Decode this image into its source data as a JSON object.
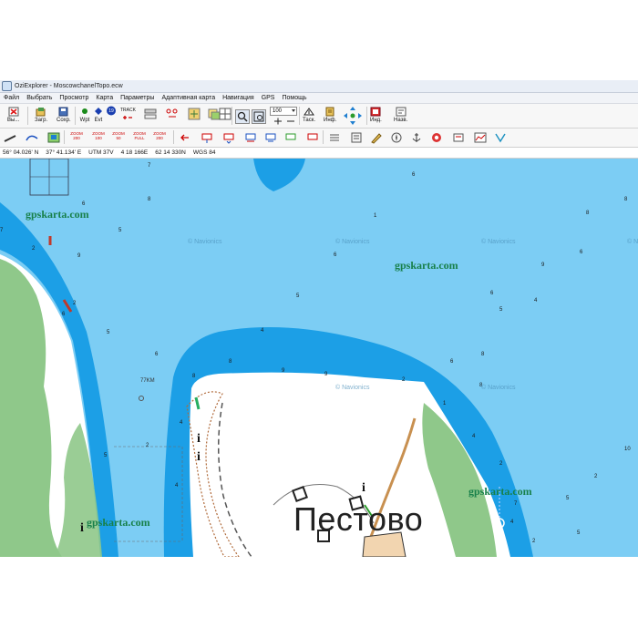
{
  "window": {
    "title": "OziExplorer - MoscowchanelTopo.ecw"
  },
  "menu": [
    "Файл",
    "Выбрать",
    "Просмотр",
    "Карта",
    "Параметры",
    "Адаптивная карта",
    "Навигация",
    "GPS",
    "Помощь"
  ],
  "toolbar": {
    "exit_label": "Вы...",
    "load_label": "Загр.",
    "save_label": "Сохр.",
    "wpt_label": "Wpt",
    "evt_label": "Evt",
    "track_label": "TRACK",
    "waypoint_count": "19",
    "zoom_value": "100",
    "task_label": "Таск.",
    "info_label": "Инф.",
    "ind_label": "Инд.",
    "name_label": "Назв."
  },
  "toolbar2": {
    "zoom200": "ZOOM 200",
    "zoom100": "ZOOM 100",
    "zoom50": "ZOOM 50",
    "zoomfull": "ZOOM FULL",
    "zoom200b": "ZOOM 200"
  },
  "status": {
    "lat": "56° 04.026' N",
    "lon": "37° 41.134' E",
    "utm": "UTM  37V",
    "easting": "4 18 166E",
    "northing": "62 14 330N",
    "datum": "WGS 84"
  },
  "map": {
    "brand_watermark": "gpskarta.com",
    "faint_watermark": "© Navionics",
    "town_label": "Пестово",
    "marker_label": "77KM",
    "depths": [
      "7",
      "6",
      "8",
      "6",
      "8",
      "5",
      "8",
      "1",
      "7",
      "6",
      "2",
      "6",
      "9",
      "9",
      "5",
      "6",
      "4",
      "6",
      "2",
      "5",
      "4",
      "5",
      "6",
      "8",
      "8",
      "6",
      "9",
      "9",
      "8",
      "2",
      "8",
      "1",
      "4",
      "4",
      "2",
      "5",
      "2",
      "4",
      "2",
      "7",
      "5",
      "4",
      "5",
      "2",
      "3",
      "7",
      "3",
      "8",
      "2",
      "7",
      "5",
      "1",
      "6",
      "7",
      "10"
    ]
  },
  "colors": {
    "water": "#7ccdf4",
    "channel": "#1c9fe6",
    "land": "#ffffff",
    "forest": "#8fc88a",
    "brand": "#18804a"
  }
}
